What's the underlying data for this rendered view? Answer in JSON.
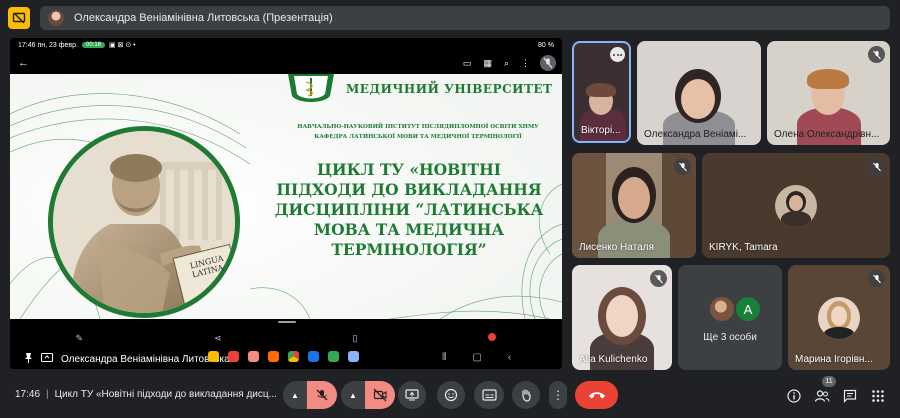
{
  "topbar": {
    "presenting_title": "Олександра Веніамінівна Литовська (Презентація)"
  },
  "phone": {
    "status_time": "17:46",
    "status_date": "пн, 23 февр.",
    "call_chip": "00:16",
    "battery": "80 %"
  },
  "slide": {
    "university": "МЕДИЧНИЙ УНІВЕРСИТЕТ",
    "institute_line1": "НАВЧАЛЬНО-НАУКОВИЙ ІНСТИТУТ ПІСЛЯДИПЛОМНОЇ ОСВІТИ ХНМУ",
    "institute_line2": "КАФЕДРА ЛАТИНСЬКОЇ МОВИ ТА МЕДИЧНОЇ ТЕРМІНОЛОГІЇ",
    "title_lines": [
      "ЦИКЛ ТУ «НОВІТНІ",
      "ПІДХОДИ ДО ВИКЛАДАННЯ",
      "ДИСЦИПЛІНИ “ЛАТИНСЬКА",
      "МОВА ТА МЕДИЧНА",
      "ТЕРМІНОЛОГІЯ”"
    ],
    "book_text_line1": "LINGUA",
    "book_text_line2": "LATINA",
    "green": "#1d7a32"
  },
  "presenter": {
    "name": "Олександра Веніамінівна Литовська"
  },
  "participants": [
    {
      "name": "Вікторі...",
      "muted": false
    },
    {
      "name": "Олександра Веніамі...",
      "muted": false
    },
    {
      "name": "Олена Олександрівн...",
      "muted": true
    },
    {
      "name": "Лисенко Наталя",
      "muted": true
    },
    {
      "name": "KIRYK, Tamara",
      "muted": true
    },
    {
      "name": "Alla Kulichenko",
      "muted": true
    },
    {
      "name": "Марина Ігорівн...",
      "muted": true
    }
  ],
  "others": {
    "label": "Ще 3 особи",
    "avatar_letter": "A"
  },
  "controls": {
    "time": "17:46",
    "meeting_title": "Цикл ТУ «Новітні підходи до викладання дисц...",
    "participant_count": "11",
    "end_call_color": "#ea4335",
    "mic_off_color": "#f28b82"
  }
}
